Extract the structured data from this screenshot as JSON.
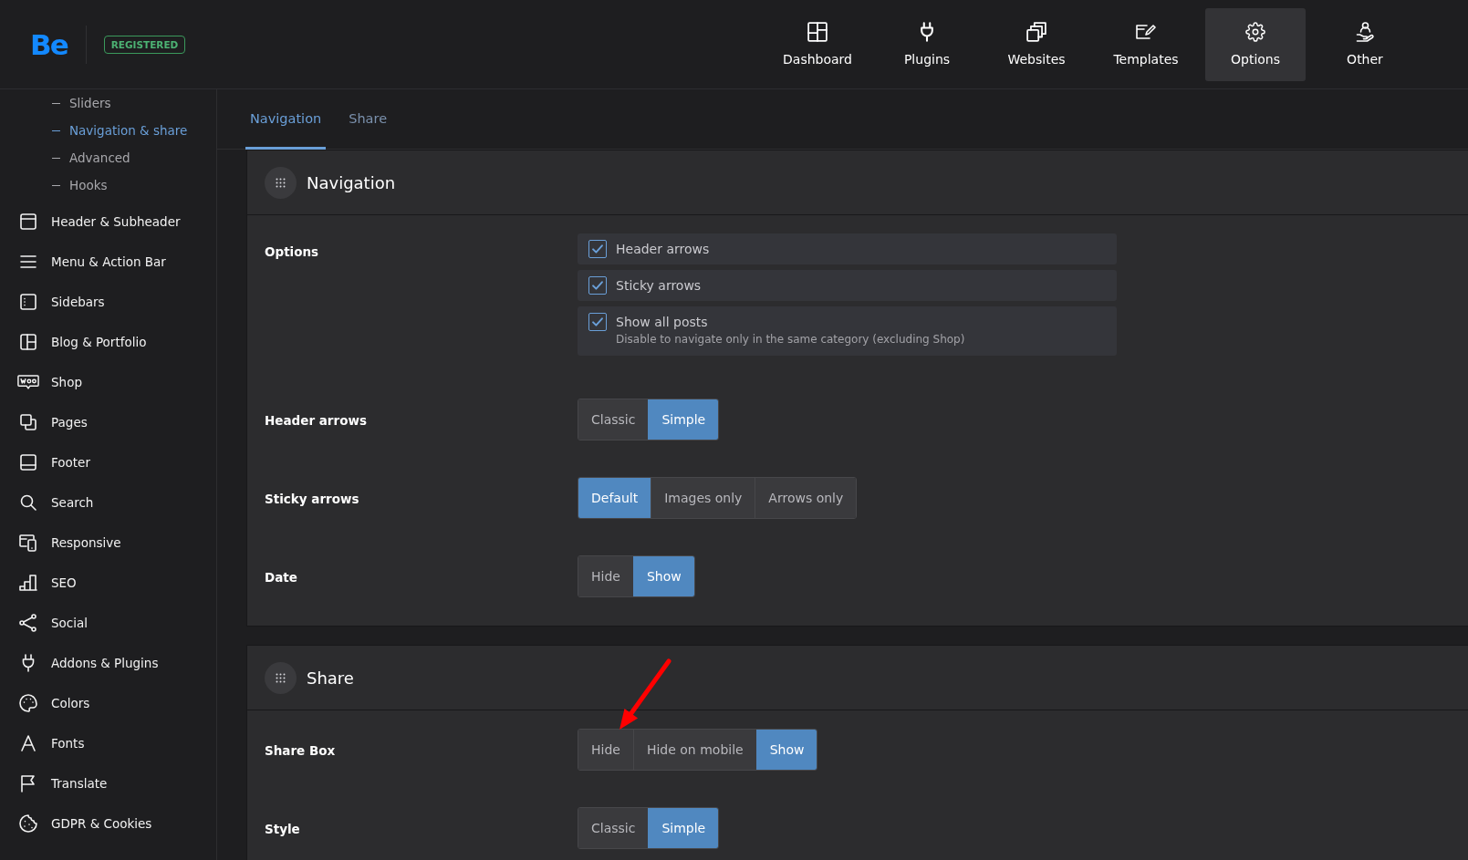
{
  "header": {
    "logo": "Be",
    "badge": "REGISTERED",
    "nav": [
      {
        "label": "Dashboard",
        "selected": false
      },
      {
        "label": "Plugins",
        "selected": false
      },
      {
        "label": "Websites",
        "selected": false
      },
      {
        "label": "Templates",
        "selected": false
      },
      {
        "label": "Options",
        "selected": true
      },
      {
        "label": "Other",
        "selected": false
      }
    ]
  },
  "sidebar": {
    "subitems": [
      {
        "label": "Sliders",
        "selected": false
      },
      {
        "label": "Navigation & share",
        "selected": true
      },
      {
        "label": "Advanced",
        "selected": false
      },
      {
        "label": "Hooks",
        "selected": false
      }
    ],
    "items": [
      {
        "label": "Header & Subheader"
      },
      {
        "label": "Menu & Action Bar"
      },
      {
        "label": "Sidebars"
      },
      {
        "label": "Blog & Portfolio"
      },
      {
        "label": "Shop"
      },
      {
        "label": "Pages"
      },
      {
        "label": "Footer"
      },
      {
        "label": "Search"
      },
      {
        "label": "Responsive"
      },
      {
        "label": "SEO"
      },
      {
        "label": "Social"
      },
      {
        "label": "Addons & Plugins"
      },
      {
        "label": "Colors"
      },
      {
        "label": "Fonts"
      },
      {
        "label": "Translate"
      },
      {
        "label": "GDPR & Cookies"
      }
    ]
  },
  "tabs": [
    {
      "label": "Navigation",
      "selected": true
    },
    {
      "label": "Share",
      "selected": false
    }
  ],
  "sections": [
    {
      "title": "Navigation",
      "rows": [
        {
          "label": "Options",
          "kind": "checkboxes",
          "options": [
            {
              "label": "Header arrows",
              "checked": true
            },
            {
              "label": "Sticky arrows",
              "checked": true
            },
            {
              "label": "Show all posts",
              "checked": true,
              "description": "Disable to navigate only in the same category (excluding Shop)"
            }
          ]
        },
        {
          "label": "Header arrows",
          "kind": "segmented",
          "options": [
            {
              "label": "Classic",
              "selected": false
            },
            {
              "label": "Simple",
              "selected": true
            }
          ]
        },
        {
          "label": "Sticky arrows",
          "kind": "segmented",
          "options": [
            {
              "label": "Default",
              "selected": true
            },
            {
              "label": "Images only",
              "selected": false
            },
            {
              "label": "Arrows only",
              "selected": false
            }
          ]
        },
        {
          "label": "Date",
          "kind": "segmented",
          "options": [
            {
              "label": "Hide",
              "selected": false
            },
            {
              "label": "Show",
              "selected": true
            }
          ]
        }
      ]
    },
    {
      "title": "Share",
      "rows": [
        {
          "label": "Share Box",
          "kind": "segmented",
          "options": [
            {
              "label": "Hide",
              "selected": false
            },
            {
              "label": "Hide on mobile",
              "selected": false
            },
            {
              "label": "Show",
              "selected": true
            }
          ]
        },
        {
          "label": "Style",
          "kind": "segmented",
          "options": [
            {
              "label": "Classic",
              "selected": false
            },
            {
              "label": "Simple",
              "selected": true
            }
          ]
        }
      ]
    }
  ]
}
